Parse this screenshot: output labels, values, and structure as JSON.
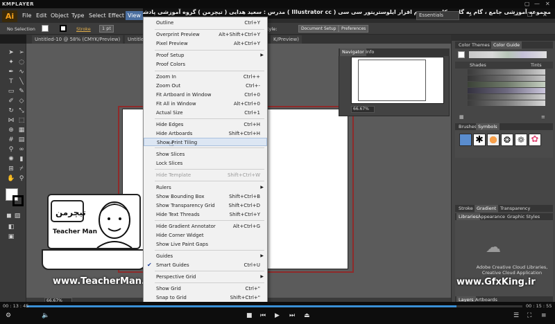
{
  "player": {
    "brand": "KMPLAYER",
    "window_controls": [
      "▢",
      "—",
      "✕"
    ],
    "elapsed": "00 : 13 : 45",
    "total": "00 : 15 : 55",
    "progress_fraction": 0.867
  },
  "course_title": "مجموعه آموزشی جامع ، گام به گام و کاربردی نرم افزار ایلوستریتور سی سی ( Illustrator cc )   مدرس : سعید هدایی ( تیچرمن ) گروه آموزشی پادشاه گرافیست ها",
  "app": {
    "logo": "Ai",
    "menus": [
      "File",
      "Edit",
      "Object",
      "Type",
      "Select",
      "Effect",
      "View"
    ],
    "workspace": "Essentials"
  },
  "control_bar": {
    "selection": "No Selection",
    "stroke_label": "Stroke",
    "stroke_value": "1 pt",
    "style_label": "tyle:",
    "document_setup": "Document Setup",
    "preferences": "Preferences"
  },
  "doc_tabs": [
    "Untitled-10 @ 58% (CMYK/Preview)",
    "Untitled",
    "K/Preview)"
  ],
  "view_menu": {
    "items": [
      {
        "label": "Outline",
        "shortcut": "Ctrl+Y"
      },
      {
        "label": "Overprint Preview",
        "shortcut": "Alt+Shift+Ctrl+Y"
      },
      {
        "label": "Pixel Preview",
        "shortcut": "Alt+Ctrl+Y"
      },
      {
        "label": "Proof Setup",
        "shortcut": "",
        "submenu": true
      },
      {
        "label": "Proof Colors",
        "shortcut": ""
      },
      {
        "label": "Zoom In",
        "shortcut": "Ctrl++"
      },
      {
        "label": "Zoom Out",
        "shortcut": "Ctrl+-"
      },
      {
        "label": "Fit Artboard in Window",
        "shortcut": "Ctrl+0"
      },
      {
        "label": "Fit All in Window",
        "shortcut": "Alt+Ctrl+0"
      },
      {
        "label": "Actual Size",
        "shortcut": "Ctrl+1"
      },
      {
        "label": "Hide Edges",
        "shortcut": "Ctrl+H"
      },
      {
        "label": "Hide Artboards",
        "shortcut": "Shift+Ctrl+H"
      },
      {
        "label": "Show Print Tiling",
        "shortcut": ""
      },
      {
        "label": "Show Slices",
        "shortcut": ""
      },
      {
        "label": "Lock Slices",
        "shortcut": ""
      },
      {
        "label": "Hide Template",
        "shortcut": "Shift+Ctrl+W"
      },
      {
        "label": "Rulers",
        "shortcut": "",
        "submenu": true
      },
      {
        "label": "Show Bounding Box",
        "shortcut": "Shift+Ctrl+B"
      },
      {
        "label": "Show Transparency Grid",
        "shortcut": "Shift+Ctrl+D"
      },
      {
        "label": "Hide Text Threads",
        "shortcut": "Shift+Ctrl+Y"
      },
      {
        "label": "Hide Gradient Annotator",
        "shortcut": "Alt+Ctrl+G"
      },
      {
        "label": "Hide Corner Widget",
        "shortcut": ""
      },
      {
        "label": "Show Live Paint Gaps",
        "shortcut": ""
      },
      {
        "label": "Guides",
        "shortcut": "",
        "submenu": true
      },
      {
        "label": "Smart Guides",
        "shortcut": "Ctrl+U"
      },
      {
        "label": "Perspective Grid",
        "shortcut": "",
        "submenu": true
      },
      {
        "label": "Show Grid",
        "shortcut": "Ctrl+\""
      },
      {
        "label": "Snap to Grid",
        "shortcut": "Shift+Ctrl+\""
      }
    ]
  },
  "navigator": {
    "tabs": [
      "Navigator",
      "Info"
    ],
    "zoom": "66.67%"
  },
  "color_panel": {
    "tabs": [
      "Color Themes",
      "Color Guide"
    ],
    "shades_label": "Shades",
    "tints_label": "Tints"
  },
  "brush_panel": {
    "tabs": [
      "Brushes",
      "Symbols"
    ]
  },
  "stroke_panel": {
    "tabs": [
      "Stroke",
      "Gradient",
      "Transparency"
    ]
  },
  "libraries_panel": {
    "tabs": [
      "Libraries",
      "Appearance",
      "Graphic Styles"
    ],
    "message": "Adobe Creative Cloud Libraries, Creative Cloud Application"
  },
  "layers_panel": {
    "tabs": [
      "Layers",
      "Artboards"
    ]
  },
  "status": {
    "zoom": "66.67%"
  },
  "watermarks": {
    "teacher_name": "Teacher Man",
    "teacher_persian": "تیچرمن",
    "teacher_url": "www.TeacherMan.ir",
    "gfx_url": "www.GfxKing.ir"
  }
}
